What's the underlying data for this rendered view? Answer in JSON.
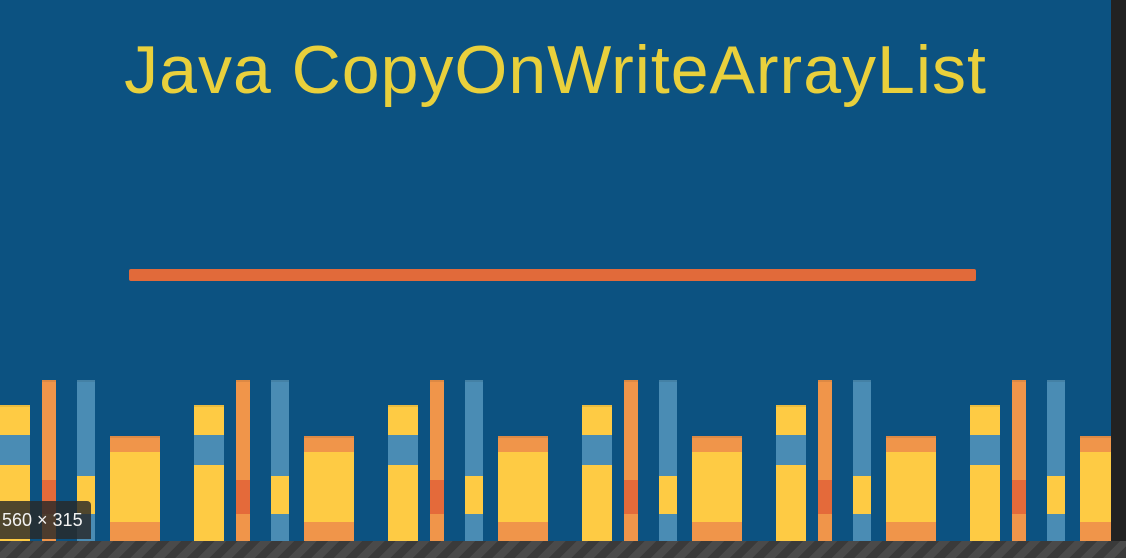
{
  "image": {
    "title": "Java CopyOnWriteArrayList",
    "colors": {
      "background": "#0c5281",
      "title": "#e9d03c",
      "divider": "#e16a3a",
      "book_yellow": "#fecb44",
      "book_orange": "#f0954a",
      "book_red": "#e46a3a",
      "book_blue": "#4a8cb4"
    }
  },
  "viewer": {
    "size_badge": "560 × 315"
  }
}
